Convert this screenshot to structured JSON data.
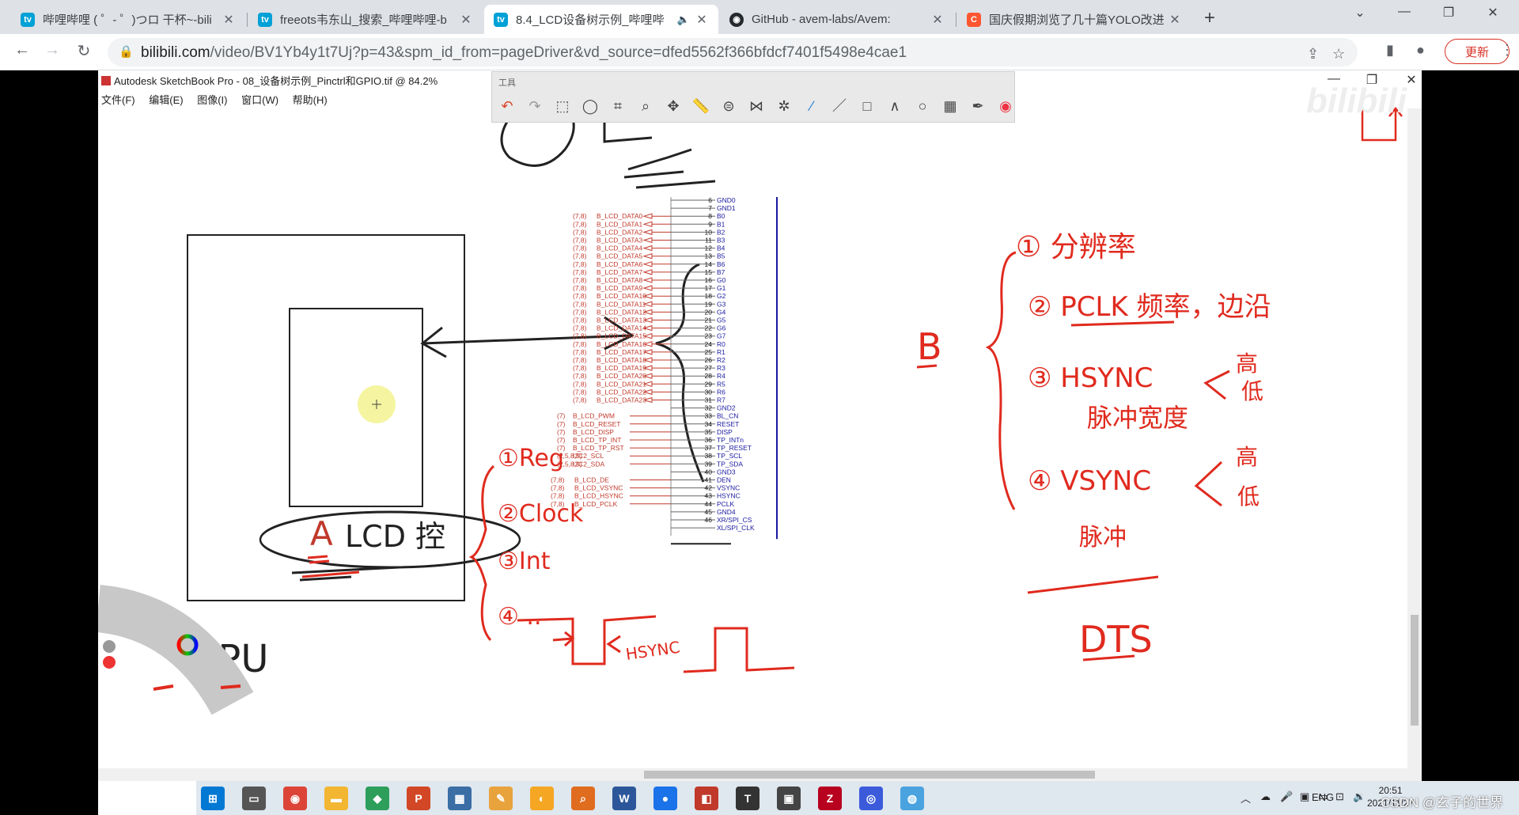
{
  "tabs": [
    {
      "title": "哔哩哔哩 ( ゜- ゜)つロ 干杯~-bili",
      "favicon_color": "#00a1d6",
      "active": false
    },
    {
      "title": "freeots韦东山_搜索_哔哩哔哩-b",
      "favicon_color": "#00a1d6",
      "active": false
    },
    {
      "title": "8.4_LCD设备树示例_哔哩哔",
      "favicon_color": "#00a1d6",
      "active": true
    },
    {
      "title": "GitHub - avem-labs/Avem:",
      "favicon_color": "#24292e",
      "active": false
    },
    {
      "title": "国庆假期浏览了几十篇YOLO改进",
      "favicon_color": "#fc5531",
      "active": false
    }
  ],
  "address": {
    "host": "bilibili.com",
    "path": "/video/BV1Yb4y1t7Uj?p=43&spm_id_from=pageDriver&vd_source=dfed5562f366bfdcf7401f5498e4cae1"
  },
  "toolbar": {
    "update_label": "更新"
  },
  "sketchbook": {
    "title": "Autodesk SketchBook Pro - 08_设备树示例_Pinctrl和GPIO.tif @ 84.2%",
    "menu": [
      "文件(F)",
      "编辑(E)",
      "图像(I)",
      "窗口(W)",
      "帮助(H)"
    ],
    "tool_panel_label": "工具",
    "watermark": "bilibili"
  },
  "drawing": {
    "mpu_label": "MPU",
    "lcd_label": "LCD 控",
    "a_label": "A",
    "b_label": "B",
    "notes_left": [
      "①Reg",
      "②Clock",
      "③Int",
      "④ .."
    ],
    "notes_right": [
      "① 分辨率",
      "② PCLK 频率，边沿",
      "③ HSYNC",
      "脉冲宽度",
      "高",
      "低",
      "④ VSYNC",
      "高",
      "低",
      "脉冲",
      "DTS"
    ],
    "hsync_label": "HSYNC",
    "colors": {
      "ink": "#e02a1e",
      "schematic": "#c0392b",
      "pin": "#1a1aa0"
    }
  },
  "schematic": {
    "data_nets": [
      "B_LCD_DATA0",
      "B_LCD_DATA1",
      "B_LCD_DATA2",
      "B_LCD_DATA3",
      "B_LCD_DATA4",
      "B_LCD_DATA5",
      "B_LCD_DATA6",
      "B_LCD_DATA7",
      "B_LCD_DATA8",
      "B_LCD_DATA9",
      "B_LCD_DATA10",
      "B_LCD_DATA11",
      "B_LCD_DATA12",
      "B_LCD_DATA13",
      "B_LCD_DATA14",
      "B_LCD_DATA15",
      "B_LCD_DATA16",
      "B_LCD_DATA17",
      "B_LCD_DATA18",
      "B_LCD_DATA19",
      "B_LCD_DATA20",
      "B_LCD_DATA21",
      "B_LCD_DATA22",
      "B_LCD_DATA23"
    ],
    "data_ref": "(7,8)",
    "ctrl_nets": [
      {
        "ref": "(7)",
        "name": "B_LCD_PWM"
      },
      {
        "ref": "(7)",
        "name": "B_LCD_RESET"
      },
      {
        "ref": "(7)",
        "name": "B_LCD_DISP"
      },
      {
        "ref": "(7)",
        "name": "B_LCD_TP_INT"
      },
      {
        "ref": "(7)",
        "name": "B_LCD_TP_RST"
      },
      {
        "ref": "(2,5,8,9)",
        "name": "I2C2_SCL"
      },
      {
        "ref": "(2,5,8,9)",
        "name": "I2C2_SDA"
      }
    ],
    "sync_nets": [
      {
        "ref": "(7,8)",
        "name": "B_LCD_DE"
      },
      {
        "ref": "(7,8)",
        "name": "B_LCD_VSYNC"
      },
      {
        "ref": "(7,8)",
        "name": "B_LCD_HSYNC"
      },
      {
        "ref": "(7,8)",
        "name": "B_LCD_PCLK"
      }
    ],
    "pins": [
      {
        "num": "6",
        "name": "GND0"
      },
      {
        "num": "7",
        "name": "GND1"
      },
      {
        "num": "8",
        "name": "B0"
      },
      {
        "num": "9",
        "name": "B1"
      },
      {
        "num": "10",
        "name": "B2"
      },
      {
        "num": "11",
        "name": "B3"
      },
      {
        "num": "12",
        "name": "B4"
      },
      {
        "num": "13",
        "name": "B5"
      },
      {
        "num": "14",
        "name": "B6"
      },
      {
        "num": "15",
        "name": "B7"
      },
      {
        "num": "16",
        "name": "G0"
      },
      {
        "num": "17",
        "name": "G1"
      },
      {
        "num": "18",
        "name": "G2"
      },
      {
        "num": "19",
        "name": "G3"
      },
      {
        "num": "20",
        "name": "G4"
      },
      {
        "num": "21",
        "name": "G5"
      },
      {
        "num": "22",
        "name": "G6"
      },
      {
        "num": "23",
        "name": "G7"
      },
      {
        "num": "24",
        "name": "R0"
      },
      {
        "num": "25",
        "name": "R1"
      },
      {
        "num": "26",
        "name": "R2"
      },
      {
        "num": "27",
        "name": "R3"
      },
      {
        "num": "28",
        "name": "R4"
      },
      {
        "num": "29",
        "name": "R5"
      },
      {
        "num": "30",
        "name": "R6"
      },
      {
        "num": "31",
        "name": "R7"
      },
      {
        "num": "32",
        "name": "GND2"
      },
      {
        "num": "33",
        "name": "BL_CN"
      },
      {
        "num": "34",
        "name": "RESET"
      },
      {
        "num": "35",
        "name": "DISP"
      },
      {
        "num": "36",
        "name": "TP_INTn"
      },
      {
        "num": "37",
        "name": "TP_RESET"
      },
      {
        "num": "38",
        "name": "TP_SCL"
      },
      {
        "num": "39",
        "name": "TP_SDA"
      },
      {
        "num": "40",
        "name": "GND3"
      },
      {
        "num": "41",
        "name": "DEN"
      },
      {
        "num": "42",
        "name": "VSYNC"
      },
      {
        "num": "43",
        "name": "HSYNC"
      },
      {
        "num": "44",
        "name": "PCLK"
      },
      {
        "num": "45",
        "name": "GND4"
      },
      {
        "num": "46",
        "name": "XR/SPI_CS"
      },
      {
        "num": "",
        "name": "XL/SPI_CLK"
      }
    ]
  },
  "taskbar": {
    "apps": [
      {
        "name": "windows-start",
        "color": "#0078d4",
        "glyph": "⊞"
      },
      {
        "name": "task-view",
        "color": "#555",
        "glyph": "▭"
      },
      {
        "name": "chrome",
        "color": "#db4437",
        "glyph": "◉"
      },
      {
        "name": "file-explorer",
        "color": "#f2b632",
        "glyph": "▬"
      },
      {
        "name": "app-5",
        "color": "#2e9e5b",
        "glyph": "◆"
      },
      {
        "name": "powerpoint",
        "color": "#d24726",
        "glyph": "P"
      },
      {
        "name": "calculator",
        "color": "#3a6ea5",
        "glyph": "▦"
      },
      {
        "name": "app-8",
        "color": "#e8a33d",
        "glyph": "✎"
      },
      {
        "name": "app-9",
        "color": "#f5a623",
        "glyph": "◐"
      },
      {
        "name": "search-app",
        "color": "#e06c1f",
        "glyph": "⌕"
      },
      {
        "name": "word",
        "color": "#2b579a",
        "glyph": "W"
      },
      {
        "name": "app-12",
        "color": "#1a73e8",
        "glyph": "●"
      },
      {
        "name": "sketchbook",
        "color": "#c0392b",
        "glyph": "◧"
      },
      {
        "name": "typora",
        "color": "#333",
        "glyph": "T"
      },
      {
        "name": "app-15",
        "color": "#444",
        "glyph": "▣"
      },
      {
        "name": "filezilla",
        "color": "#b8001f",
        "glyph": "Z"
      },
      {
        "name": "app-17",
        "color": "#3b5bdb",
        "glyph": "◎"
      },
      {
        "name": "app-18",
        "color": "#4aa3df",
        "glyph": "◍"
      }
    ],
    "tray_lang": "ENG",
    "time": "20:51",
    "date": "2021/11/27",
    "watermark": "CSDN @玄子的世界"
  }
}
